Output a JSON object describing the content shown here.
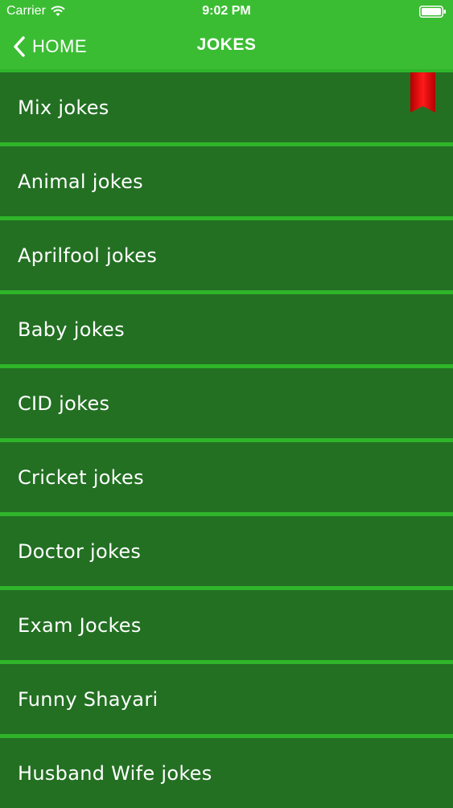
{
  "status_bar": {
    "carrier": "Carrier",
    "time": "9:02 PM",
    "wifi_icon": "wifi-icon",
    "battery_icon": "battery-icon"
  },
  "nav_bar": {
    "back_label": "HOME",
    "back_icon": "chevron-left-icon",
    "title": "JOKES"
  },
  "colors": {
    "header_green": "#3bbd33",
    "item_green": "#237023",
    "separator_green": "#2fb52a",
    "bookmark_red": "#e00000"
  },
  "categories": [
    {
      "label": "Mix jokes",
      "bookmarked": true
    },
    {
      "label": "Animal jokes"
    },
    {
      "label": "Aprilfool jokes"
    },
    {
      "label": "Baby jokes"
    },
    {
      "label": "CID jokes"
    },
    {
      "label": "Cricket jokes"
    },
    {
      "label": "Doctor jokes"
    },
    {
      "label": "Exam Jockes"
    },
    {
      "label": "Funny Shayari"
    },
    {
      "label": "Husband Wife jokes"
    }
  ]
}
